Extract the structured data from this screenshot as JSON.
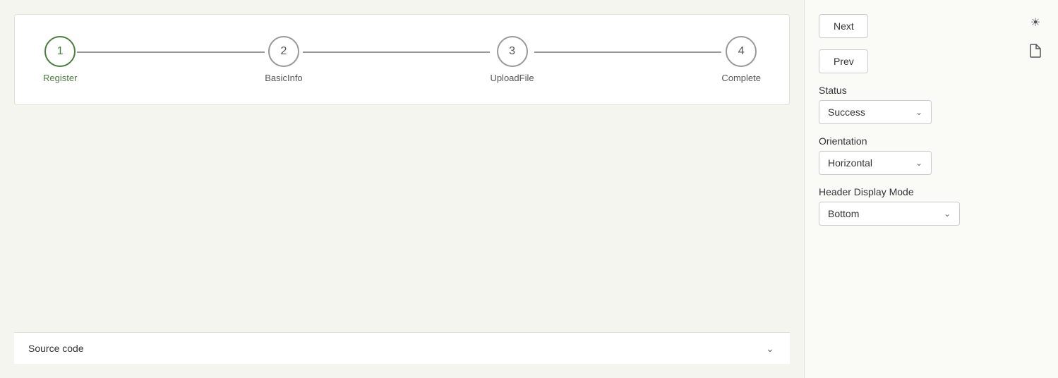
{
  "stepper": {
    "steps": [
      {
        "number": "1",
        "label": "Register",
        "active": true
      },
      {
        "number": "2",
        "label": "BasicInfo",
        "active": false
      },
      {
        "number": "3",
        "label": "UploadFile",
        "active": false
      },
      {
        "number": "4",
        "label": "Complete",
        "active": false
      }
    ]
  },
  "source_code_bar": {
    "label": "Source code"
  },
  "right_panel": {
    "next_button": "Next",
    "prev_button": "Prev",
    "status_label": "Status",
    "status_value": "Success",
    "orientation_label": "Orientation",
    "orientation_value": "Horizontal",
    "header_display_label": "Header Display Mode",
    "header_display_value": "Bottom"
  },
  "icons": {
    "theme_toggle": "☀",
    "file_icon": "🗋",
    "chevron_down": "∨"
  }
}
